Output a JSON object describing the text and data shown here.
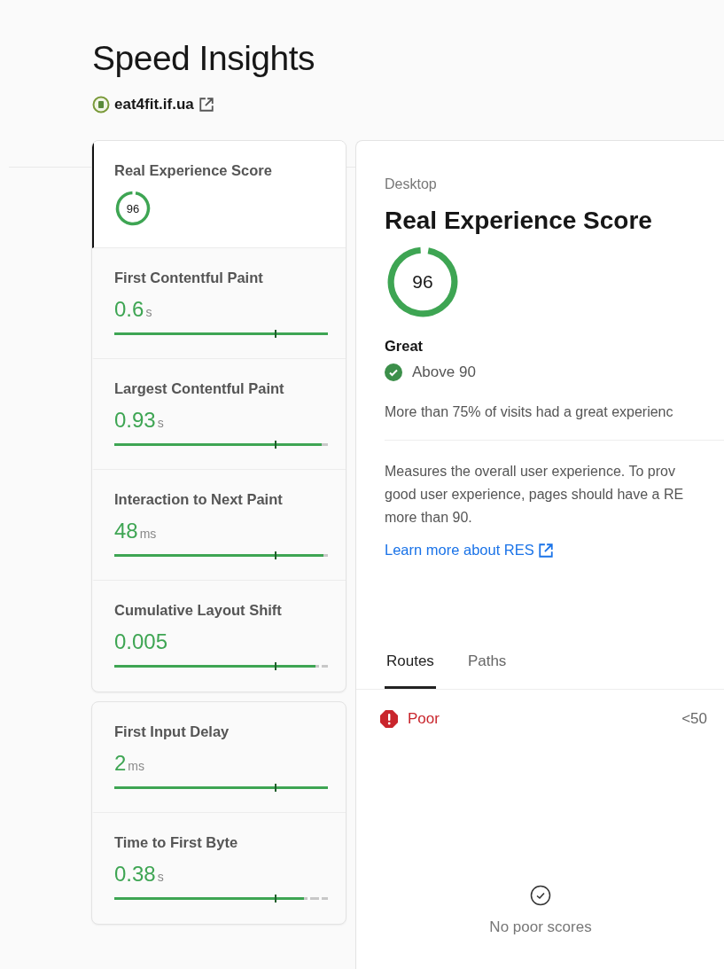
{
  "page": {
    "title": "Speed Insights",
    "site": "eat4fit.if.ua"
  },
  "metric_groups": [
    {
      "metrics": [
        {
          "name": "Real Experience Score",
          "kind": "score",
          "value": "96",
          "level": 0.96,
          "selected": true
        },
        {
          "name": "First Contentful Paint",
          "kind": "timing",
          "value": "0.6",
          "unit": "s",
          "level": 1.0,
          "selected": false
        },
        {
          "name": "Largest Contentful Paint",
          "kind": "timing",
          "value": "0.93",
          "unit": "s",
          "level": 0.97,
          "selected": false
        },
        {
          "name": "Interaction to Next Paint",
          "kind": "timing",
          "value": "48",
          "unit": "ms",
          "level": 0.98,
          "selected": false
        },
        {
          "name": "Cumulative Layout Shift",
          "kind": "timing",
          "value": "0.005",
          "level": 0.94,
          "selected": false
        }
      ]
    },
    {
      "metrics": [
        {
          "name": "First Input Delay",
          "kind": "timing",
          "value": "2",
          "unit": "ms",
          "level": 1.0,
          "selected": false
        },
        {
          "name": "Time to First Byte",
          "kind": "timing",
          "value": "0.38",
          "unit": "s",
          "level": 0.89,
          "selected": false
        }
      ]
    }
  ],
  "detail": {
    "device": "Desktop",
    "title": "Real Experience Score",
    "score": "96",
    "level": 0.96,
    "rating": "Great",
    "threshold": "Above 90",
    "summary": "More than 75% of visits had a great experienc",
    "description_lines": [
      "Measures the overall user experience. To prov",
      "good user experience, pages should have a RE",
      "more than 90."
    ],
    "link": "Learn more about RES"
  },
  "tabs": [
    {
      "label": "Routes",
      "selected": true
    },
    {
      "label": "Paths",
      "selected": false
    }
  ],
  "rows": [
    {
      "status": "Poor",
      "range": "<50"
    }
  ],
  "empty_state": "No poor scores"
}
